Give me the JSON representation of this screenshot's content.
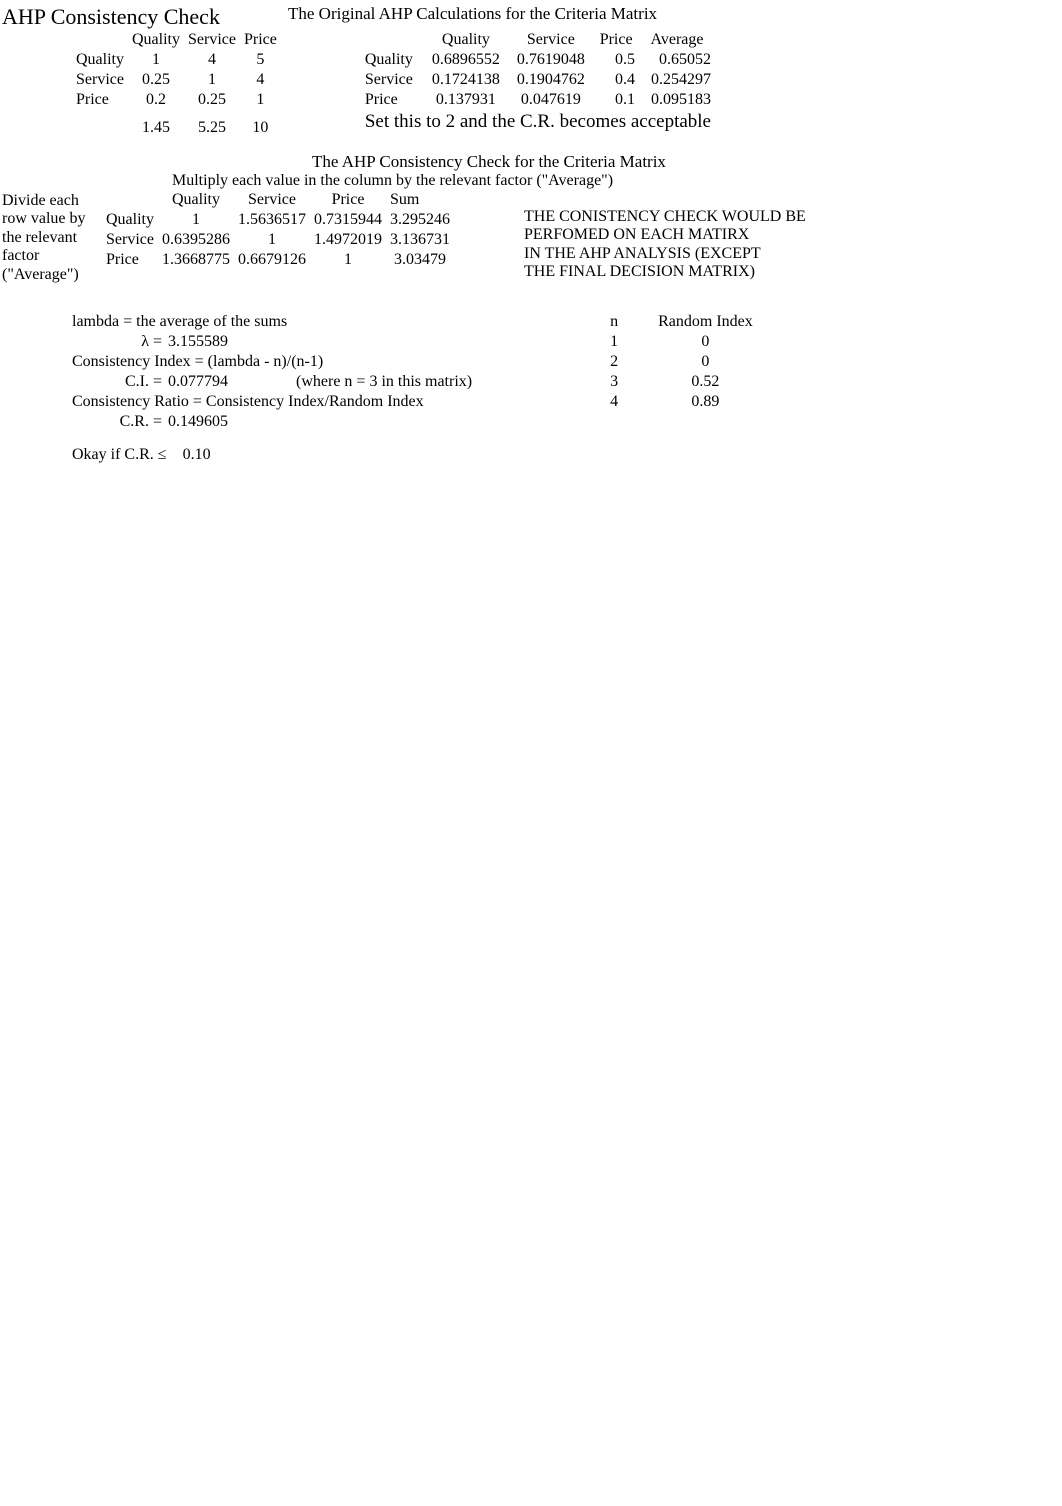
{
  "header": {
    "title": "AHP Consistency Check",
    "right_title": "The Original AHP Calculations for the Criteria Matrix"
  },
  "matrix1": {
    "cols": [
      "Quality",
      "Service",
      "Price"
    ],
    "rows": [
      {
        "label": "Quality",
        "vals": [
          "1",
          "4",
          "5"
        ]
      },
      {
        "label": "Service",
        "vals": [
          "0.25",
          "1",
          "4"
        ]
      },
      {
        "label": "Price",
        "vals": [
          "0.2",
          "0.25",
          "1"
        ]
      }
    ],
    "sums": [
      "1.45",
      "5.25",
      "10"
    ]
  },
  "matrix2": {
    "cols": [
      "Quality",
      "Service",
      "Price",
      "Average"
    ],
    "rows": [
      {
        "label": "Quality",
        "vals": [
          "0.6896552",
          "0.7619048",
          "0.5",
          "0.65052"
        ]
      },
      {
        "label": "Service",
        "vals": [
          "0.1724138",
          "0.1904762",
          "0.4",
          "0.254297"
        ]
      },
      {
        "label": "Price",
        "vals": [
          "0.137931",
          "0.047619",
          "0.1",
          "0.095183"
        ]
      }
    ],
    "note": "Set this to 2 and the C.R. becomes acceptable"
  },
  "check": {
    "title": "The AHP Consistency Check for the Criteria Matrix",
    "subtitle": "Multiply each value in the column by the relevant factor (\"Average\")",
    "side_note": "Divide each row value by the relevant factor (\"Average\")",
    "cols": [
      "Quality",
      "Service",
      "Price",
      "Sum"
    ],
    "rows": [
      {
        "label": "Quality",
        "vals": [
          "1",
          "1.5636517",
          "0.7315944",
          "3.295246"
        ]
      },
      {
        "label": "Service",
        "vals": [
          "0.6395286",
          "1",
          "1.4972019",
          "3.136731"
        ]
      },
      {
        "label": "Price",
        "vals": [
          "1.3668775",
          "0.6679126",
          "1",
          "3.03479"
        ]
      }
    ],
    "right_note": [
      "THE CONISTENCY CHECK WOULD BE",
      "PERFOMED ON EACH MATIRX",
      "IN THE AHP ANALYSIS (EXCEPT",
      "THE FINAL DECISION MATRIX)"
    ]
  },
  "calc": {
    "lambda_label": "lambda = the average of the sums",
    "lambda_sym": "λ  =",
    "lambda_val": "3.155589",
    "ci_label": "Consistency Index = (lambda - n)/(n-1)",
    "ci_sym": "C.I.  =",
    "ci_val": "0.077794",
    "ci_note": "(where n = 3 in this matrix)",
    "cr_label": "Consistency Ratio = Consistency Index/Random Index",
    "cr_sym": "C.R.  =",
    "cr_val": "0.149605",
    "ok_label": "Okay if C.R. ≤",
    "ok_val": "0.10"
  },
  "ri": {
    "head": [
      "n",
      "Random Index"
    ],
    "rows": [
      [
        "1",
        "0"
      ],
      [
        "2",
        "0"
      ],
      [
        "3",
        "0.52"
      ],
      [
        "4",
        "0.89"
      ]
    ]
  }
}
